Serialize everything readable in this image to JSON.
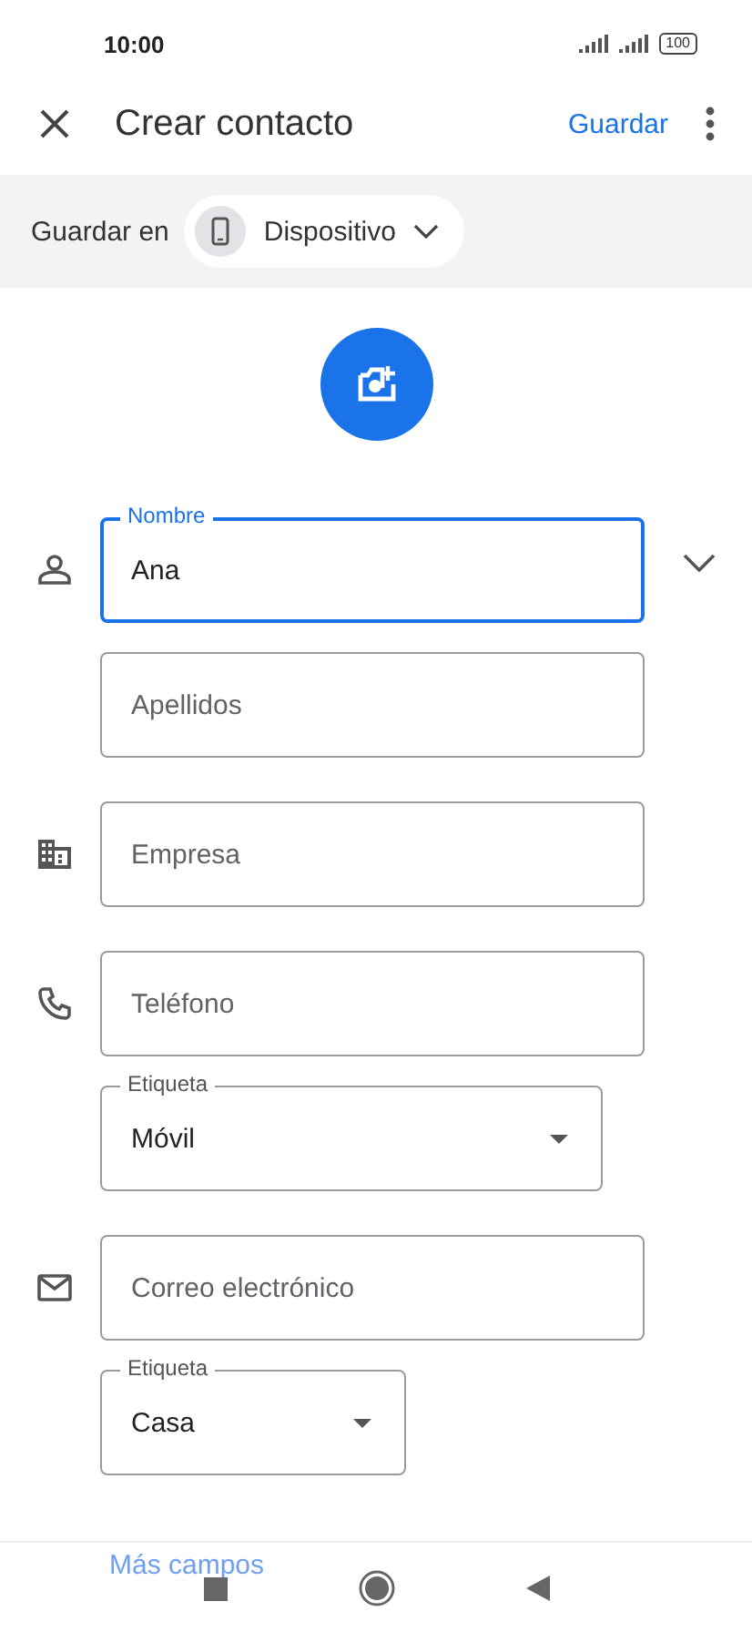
{
  "status_bar": {
    "time": "10:00",
    "battery": "100"
  },
  "app_bar": {
    "title": "Crear contacto",
    "save": "Guardar"
  },
  "save_to": {
    "label": "Guardar en",
    "account": "Dispositivo"
  },
  "groups": [
    {
      "kind": "person",
      "expandable": true,
      "fields": [
        {
          "kind": "text",
          "label": "Nombre",
          "value": "Ana",
          "focused": true
        },
        {
          "kind": "text",
          "placeholder": "Apellidos",
          "focused": false
        }
      ]
    },
    {
      "kind": "building",
      "expandable": false,
      "fields": [
        {
          "kind": "text",
          "placeholder": "Empresa",
          "focused": false
        }
      ]
    },
    {
      "kind": "phone",
      "expandable": false,
      "fields": [
        {
          "kind": "text",
          "placeholder": "Teléfono",
          "focused": false
        },
        {
          "kind": "dropdown",
          "label": "Etiqueta",
          "value": "Móvil"
        }
      ]
    },
    {
      "kind": "mail",
      "expandable": false,
      "fields": [
        {
          "kind": "text",
          "placeholder": "Correo electrónico",
          "focused": false
        },
        {
          "kind": "dropdown",
          "label": "Etiqueta",
          "value": "Casa"
        }
      ]
    }
  ],
  "more_fields": "Más campos"
}
